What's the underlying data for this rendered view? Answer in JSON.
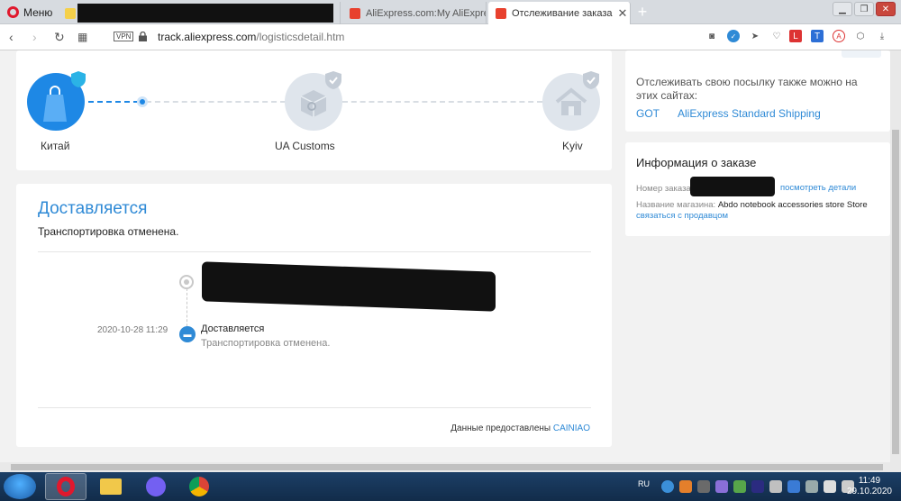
{
  "browser": {
    "menu_label": "Меню",
    "tabs": [
      {
        "title": "AliExpress.com:My AliExpress"
      },
      {
        "title": "Отслеживание заказа"
      }
    ],
    "new_tab_label": "+",
    "url_domain": "track.aliexpress.com",
    "url_path": "/logisticsdetail.htm",
    "vpn_label": "VPN"
  },
  "route": {
    "steps": [
      {
        "label": "Китай",
        "icon": "shopping-bag-icon"
      },
      {
        "label": "UA Customs",
        "icon": "customs-package-icon"
      },
      {
        "label": "Kyiv",
        "icon": "house-icon"
      }
    ]
  },
  "delivery": {
    "status_title": "Доставляется",
    "status_subtitle": "Транспортировка отменена.",
    "events": [
      {
        "time": "2020-10-28 11:29",
        "title": "Доставляется",
        "detail": "Транспортировка отменена."
      }
    ],
    "provider_label": "Данные предоставлены",
    "provider_name": "CAINIAO"
  },
  "tracking": {
    "text": "Отслеживать свою посылку также можно на этих сайтах:",
    "links": [
      "GOT",
      "AliExpress Standard Shipping"
    ]
  },
  "order_info": {
    "title": "Информация о заказе",
    "order_number_label": "Номер заказа",
    "details_link": "посмотреть детали",
    "store_label": "Название магазина:",
    "store_name": "Abdo notebook accessories store Store",
    "contact_link": "связаться с продавцом"
  },
  "taskbar": {
    "lang": "RU",
    "time": "11:49",
    "date": "29.10.2020"
  },
  "colors": {
    "accent": "#2f8ad6",
    "active_step": "#1e88e5",
    "inactive_step": "#dfe5ec"
  }
}
